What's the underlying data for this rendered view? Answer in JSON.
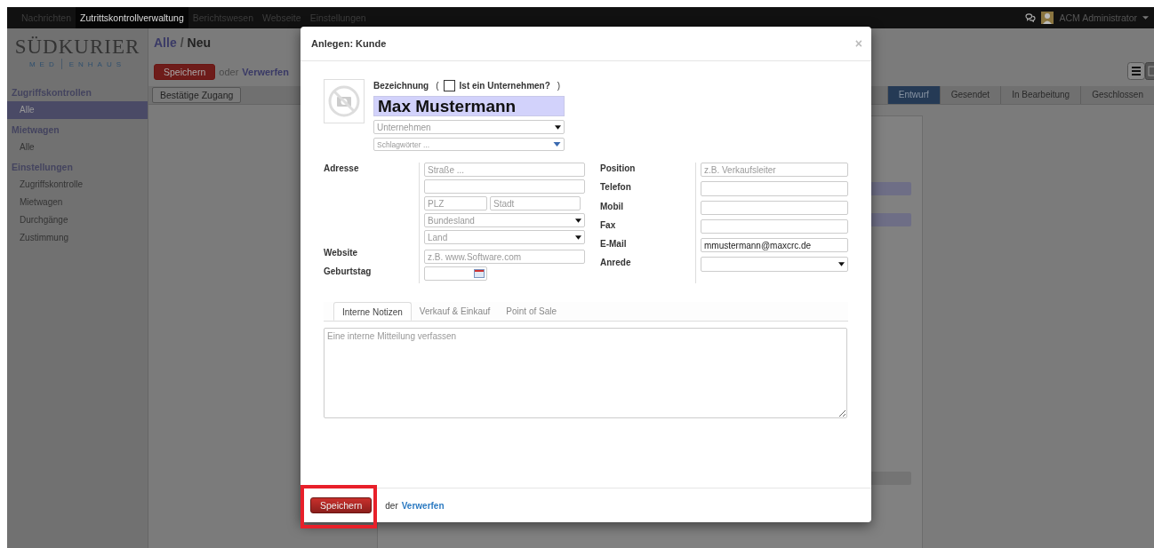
{
  "topbar": {
    "menu": [
      {
        "label": "Nachrichten",
        "selected": false
      },
      {
        "label": "Zutrittskontrollverwaltung",
        "selected": true
      },
      {
        "label": "Berichtswesen",
        "selected": false
      },
      {
        "label": "Webseite",
        "selected": false
      },
      {
        "label": "Einstellungen",
        "selected": false
      }
    ],
    "user": "ACM Administrator"
  },
  "logo": {
    "name": "SÜDKURIER",
    "sub_left": "MED",
    "sub_right": "ENHAUS"
  },
  "sidebar": [
    {
      "title": "Zugriffskontrollen",
      "items": [
        {
          "label": "Alle",
          "selected": true
        }
      ]
    },
    {
      "title": "Mietwagen",
      "items": [
        {
          "label": "Alle",
          "selected": false
        }
      ]
    },
    {
      "title": "Einstellungen",
      "items": [
        {
          "label": "Zugriffskontrolle",
          "selected": false
        },
        {
          "label": "Mietwagen",
          "selected": false
        },
        {
          "label": "Durchgänge",
          "selected": false
        },
        {
          "label": "Zustimmung",
          "selected": false
        }
      ]
    }
  ],
  "breadcrumb": {
    "parent": "Alle",
    "separator": "/",
    "current": "Neu"
  },
  "actions": {
    "save": "Speichern",
    "or": "oder",
    "discard": "Verwerfen"
  },
  "confirm_button": "Bestätige Zugang",
  "stages": [
    {
      "label": "Entwurf",
      "selected": true
    },
    {
      "label": "Gesendet",
      "selected": false
    },
    {
      "label": "In Bearbeitung",
      "selected": false
    },
    {
      "label": "Geschlossen",
      "selected": false
    }
  ],
  "modal": {
    "title": "Anlegen: Kunde",
    "close": "×",
    "name_label": "Bezeichnung",
    "company_check": {
      "open": "(",
      "label": "Ist ein Unternehmen?",
      "close": ")",
      "checked": false
    },
    "name_value": "Max Mustermann",
    "company_placeholder": "Unternehmen",
    "tags_placeholder": "Schlagwörter ...",
    "address_label": "Adresse",
    "street_placeholder": "Straße ...",
    "zip_placeholder": "PLZ",
    "city_placeholder": "Stadt",
    "state_placeholder": "Bundesland",
    "country_placeholder": "Land",
    "website_label": "Website",
    "website_placeholder": "z.B. www.Software.com",
    "birthday_label": "Geburtstag",
    "right_fields": [
      {
        "label": "Position",
        "kind": "input",
        "placeholder": "z.B. Verkaufsleiter"
      },
      {
        "label": "Telefon",
        "kind": "input"
      },
      {
        "label": "Mobil",
        "kind": "input"
      },
      {
        "label": "Fax",
        "kind": "input"
      },
      {
        "label": "E-Mail",
        "kind": "input",
        "value": "mmustermann@maxcrc.de"
      },
      {
        "label": "Anrede",
        "kind": "select"
      }
    ],
    "tabs": [
      {
        "label": "Interne Notizen",
        "selected": true
      },
      {
        "label": "Verkauf & Einkauf",
        "selected": false
      },
      {
        "label": "Point of Sale",
        "selected": false
      }
    ],
    "notes_placeholder": "Eine interne Mitteilung verfassen",
    "footer": {
      "save": "Speichern",
      "or": "der",
      "discard": "Verwerfen"
    }
  }
}
